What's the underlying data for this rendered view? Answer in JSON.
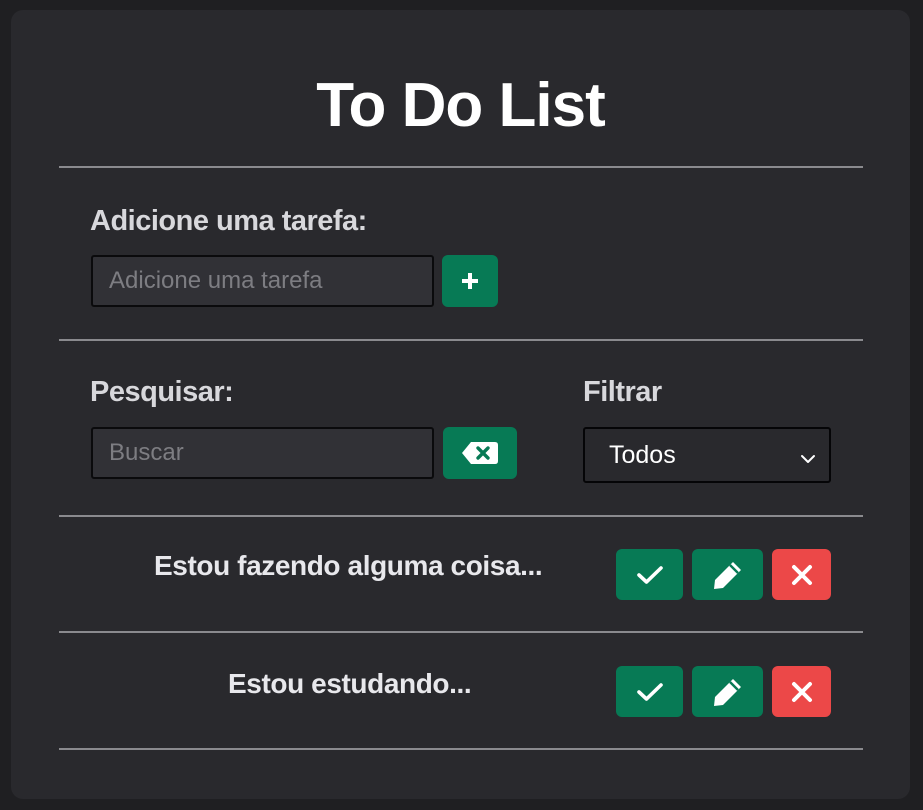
{
  "app": {
    "title": "To Do List"
  },
  "add_section": {
    "label": "Adicione uma tarefa:",
    "input_placeholder": "Adicione uma tarefa",
    "input_value": ""
  },
  "search_section": {
    "label": "Pesquisar:",
    "input_placeholder": "Buscar",
    "input_value": ""
  },
  "filter_section": {
    "label": "Filtrar",
    "selected": "Todos"
  },
  "tasks": [
    {
      "text": "Estou fazendo alguma coisa..."
    },
    {
      "text": "Estou estudando..."
    }
  ],
  "colors": {
    "accent_green": "#077a55",
    "danger_red": "#ec4848",
    "card_bg": "#29292d",
    "page_bg": "#1f1f22"
  }
}
